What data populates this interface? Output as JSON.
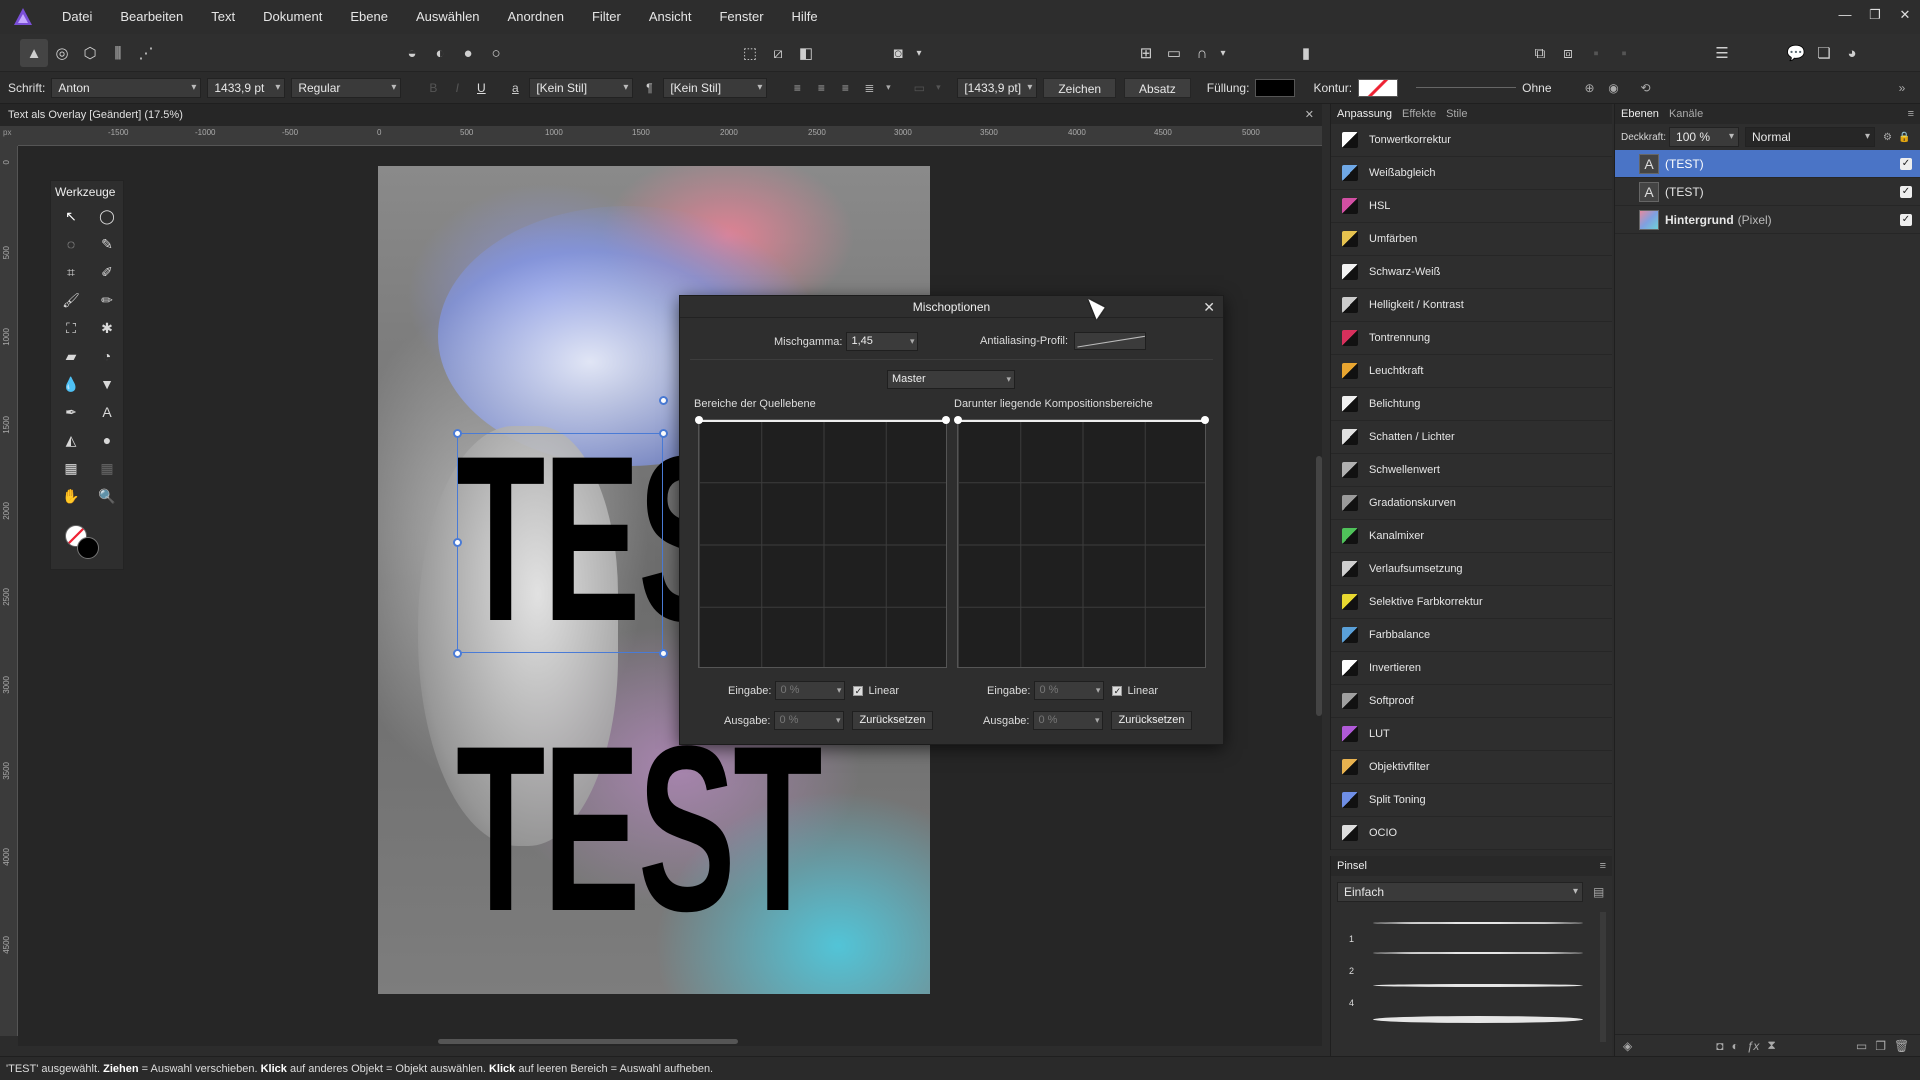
{
  "menubar": {
    "items": [
      "Datei",
      "Bearbeiten",
      "Text",
      "Dokument",
      "Ebene",
      "Auswählen",
      "Anordnen",
      "Filter",
      "Ansicht",
      "Fenster",
      "Hilfe"
    ]
  },
  "context_bar": {
    "font_label": "Schrift:",
    "font_family": "Anton",
    "font_size": "1433,9 pt",
    "font_style": "Regular",
    "underline_glyph": "U",
    "char_style_glyph": "a",
    "char_style": "[Kein Stil]",
    "para_style_glyph": "¶",
    "para_style": "[Kein Stil]",
    "size_readout": "[1433,9 pt]",
    "char_button": "Zeichen",
    "para_button": "Absatz",
    "fill_label": "Füllung:",
    "fill_color": "#000000",
    "stroke_label": "Kontur:",
    "stroke_value": "Ohne"
  },
  "document_tab": {
    "title": "Text als Overlay [Geändert] (17.5%)"
  },
  "ruler": {
    "unit": "px",
    "h_ticks": [
      "-1500",
      "-1000",
      "-500",
      "0",
      "500",
      "1000",
      "1500",
      "2000",
      "2500",
      "3000",
      "3500",
      "4000",
      "4500",
      "5000"
    ],
    "v_ticks": [
      "0",
      "500",
      "1000",
      "1500",
      "2000",
      "2500",
      "3000",
      "3500",
      "4000",
      "4500"
    ]
  },
  "canvas": {
    "text_line_1": "TEST",
    "text_line_2": "TEST"
  },
  "tools_panel": {
    "title": "Werkzeuge"
  },
  "blend_dialog": {
    "title": "Mischoptionen",
    "blend_gamma_label": "Mischgamma:",
    "blend_gamma_value": "1,45",
    "antialias_label": "Antialiasing-Profil:",
    "channel": "Master",
    "source_label": "Bereiche der Quellebene",
    "underlying_label": "Darunter liegende Kompositionsbereiche",
    "input_label": "Eingabe:",
    "output_label": "Ausgabe:",
    "left_input": "0 %",
    "left_output": "0 %",
    "right_input": "0 %",
    "right_output": "0 %",
    "linear_label": "Linear",
    "reset_button": "Zurücksetzen"
  },
  "adjustment_panel": {
    "tabs": [
      "Anpassung",
      "Effekte",
      "Stile"
    ],
    "items": [
      {
        "label": "Tonwertkorrektur",
        "color": "#ffffff"
      },
      {
        "label": "Weißabgleich",
        "color": "#6fa8e6"
      },
      {
        "label": "HSL",
        "color": "#d24fa3"
      },
      {
        "label": "Umfärben",
        "color": "#e6c24f"
      },
      {
        "label": "Schwarz-Weiß",
        "color": "#f2f2f2"
      },
      {
        "label": "Helligkeit / Kontrast",
        "color": "#cccccc"
      },
      {
        "label": "Tontrennung",
        "color": "#d8305c"
      },
      {
        "label": "Leuchtkraft",
        "color": "#e8a530"
      },
      {
        "label": "Belichtung",
        "color": "#f0f0f0"
      },
      {
        "label": "Schatten / Lichter",
        "color": "#e0e0e0"
      },
      {
        "label": "Schwellenwert",
        "color": "#b0b0b0"
      },
      {
        "label": "Gradationskurven",
        "color": "#9a9a9a"
      },
      {
        "label": "Kanalmixer",
        "color": "#4fc25a"
      },
      {
        "label": "Verlaufsumsetzung",
        "color": "#cfcfcf"
      },
      {
        "label": "Selektive Farbkorrektur",
        "color": "#e8d830"
      },
      {
        "label": "Farbbalance",
        "color": "#5aa0d8"
      },
      {
        "label": "Invertieren",
        "color": "#ffffff"
      },
      {
        "label": "Softproof",
        "color": "#a0a0a0"
      },
      {
        "label": "LUT",
        "color": "#b05ad8"
      },
      {
        "label": "Objektivfilter",
        "color": "#e8b24f"
      },
      {
        "label": "Split Toning",
        "color": "#6f8fe6"
      },
      {
        "label": "OCIO",
        "color": "#dddddd"
      }
    ]
  },
  "brush_panel": {
    "tab": "Pinsel",
    "category": "Einfach",
    "sizes": [
      "1",
      "2",
      "4"
    ]
  },
  "layers_panel": {
    "tabs": [
      "Ebenen",
      "Kanäle"
    ],
    "opacity_label": "Deckkraft:",
    "opacity_value": "100 %",
    "blend_mode": "Normal",
    "layers": [
      {
        "name": "(TEST)",
        "type": "",
        "selected": true
      },
      {
        "name": "(TEST)",
        "type": "",
        "selected": false
      },
      {
        "name": "Hintergrund",
        "type": "(Pixel)",
        "selected": false
      }
    ]
  },
  "status": {
    "part1": "'TEST' ausgewählt. ",
    "b1": "Ziehen",
    "part2": " = Auswahl verschieben. ",
    "b2": "Klick",
    "part3": " auf anderes Objekt = Objekt auswählen. ",
    "b3": "Klick",
    "part4": " auf leeren Bereich = Auswahl aufheben."
  }
}
